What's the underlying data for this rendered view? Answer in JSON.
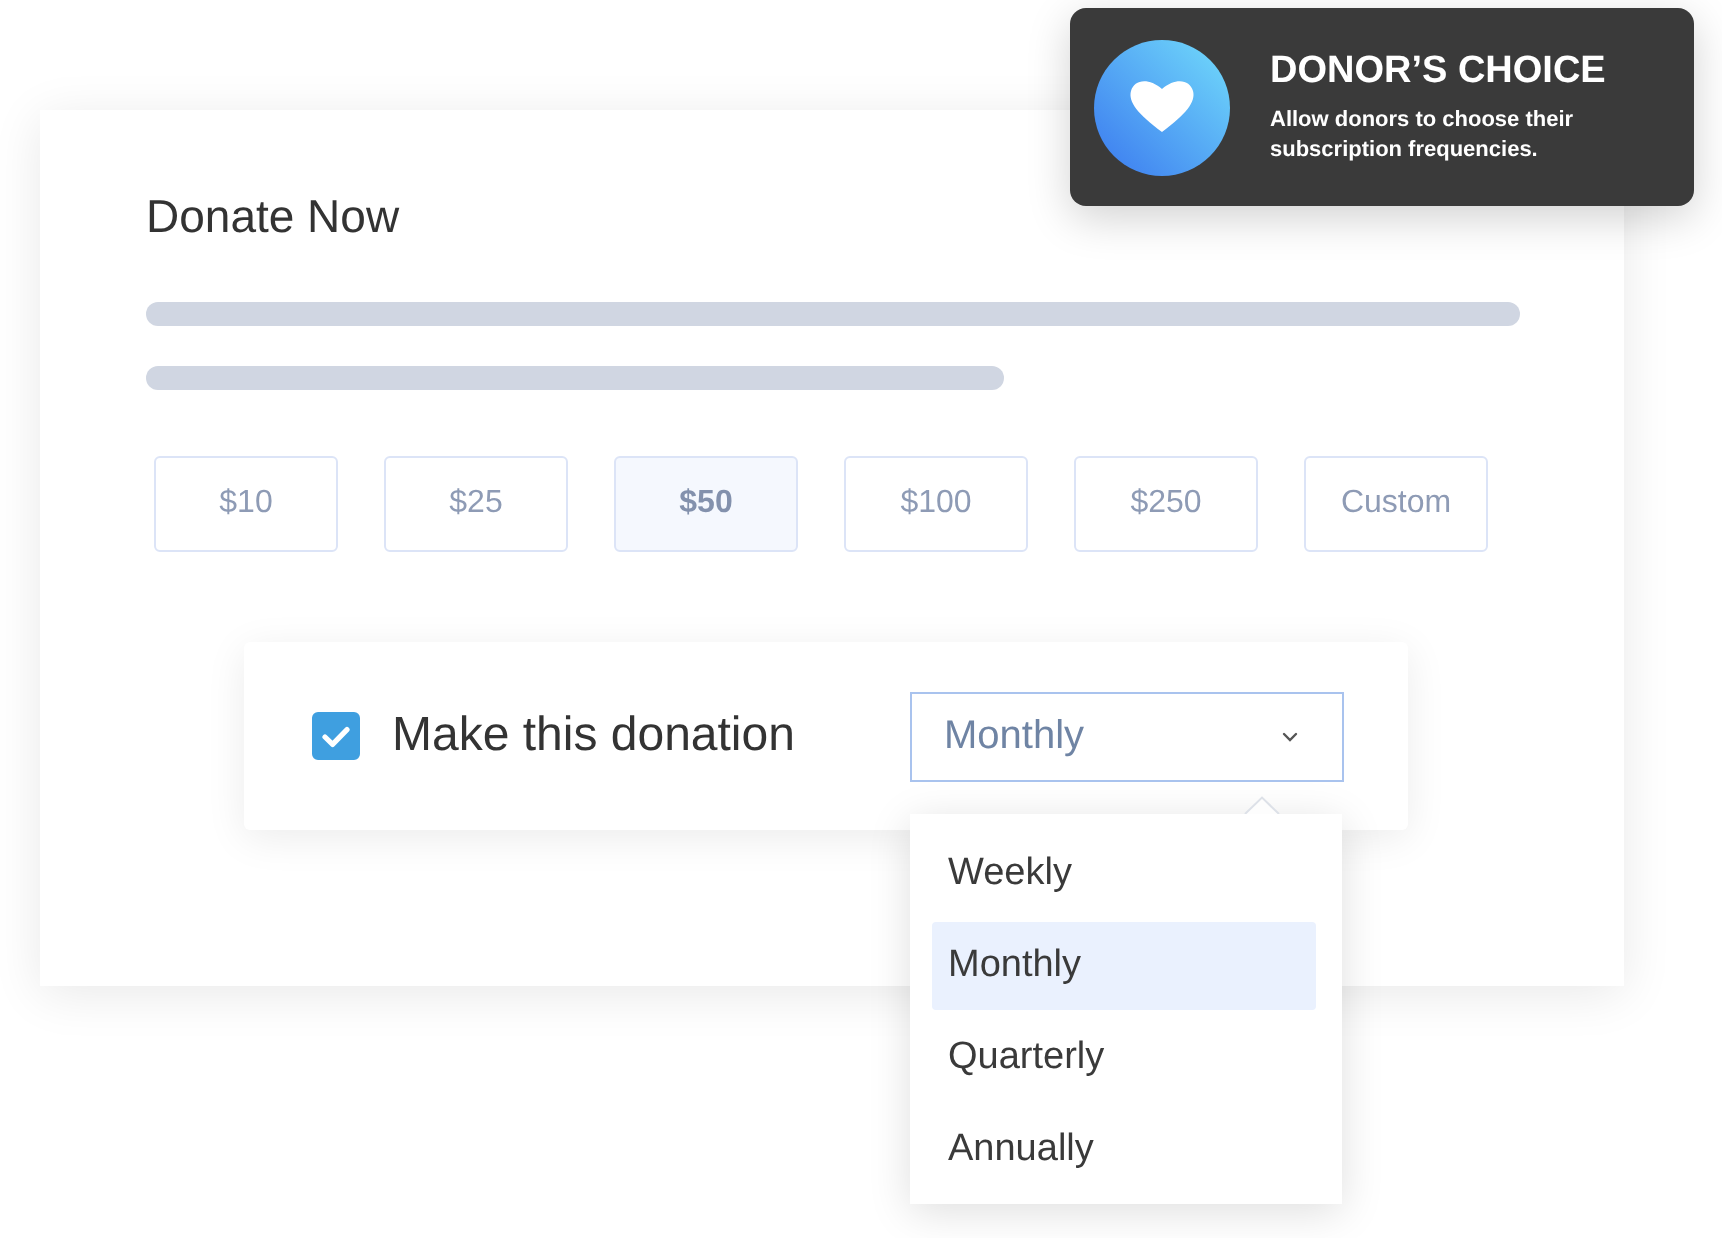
{
  "card": {
    "title": "Donate Now"
  },
  "amounts": [
    {
      "label": "$10",
      "selected": false
    },
    {
      "label": "$25",
      "selected": false
    },
    {
      "label": "$50",
      "selected": true
    },
    {
      "label": "$100",
      "selected": false
    },
    {
      "label": "$250",
      "selected": false
    },
    {
      "label": "Custom",
      "selected": false
    }
  ],
  "recurring": {
    "checked": true,
    "label": "Make this donation",
    "frequency": {
      "value": "Monthly",
      "expanded": true,
      "options": [
        {
          "label": "Weekly",
          "selected": false
        },
        {
          "label": "Monthly",
          "selected": true
        },
        {
          "label": "Quarterly",
          "selected": false
        },
        {
          "label": "Annually",
          "selected": false
        }
      ]
    }
  },
  "tooltip": {
    "title": "DONOR’S CHOICE",
    "description": "Allow donors to choose their subscription frequencies."
  }
}
